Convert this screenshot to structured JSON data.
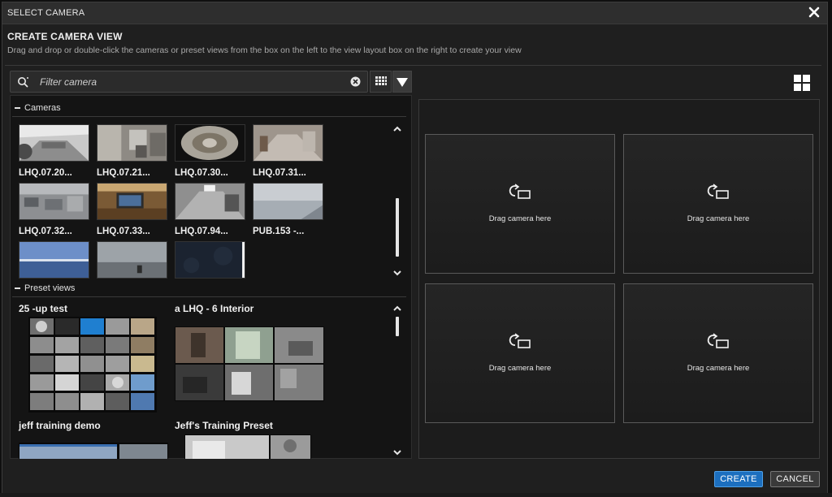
{
  "window": {
    "title": "SELECT CAMERA"
  },
  "header": {
    "title": "CREATE CAMERA VIEW",
    "instructions": "Drag and drop or double-click the cameras or preset views from the box on the left to the view layout box on the right to create your view"
  },
  "filter": {
    "placeholder": "Filter camera",
    "value": ""
  },
  "cameras": {
    "section_label": "Cameras",
    "items": [
      {
        "label": "LHQ.07.20..."
      },
      {
        "label": "LHQ.07.21..."
      },
      {
        "label": "LHQ.07.30..."
      },
      {
        "label": "LHQ.07.31..."
      },
      {
        "label": "LHQ.07.32..."
      },
      {
        "label": "LHQ.07.33..."
      },
      {
        "label": "LHQ.07.94..."
      },
      {
        "label": "PUB.153 -..."
      }
    ]
  },
  "presets": {
    "section_label": "Preset views",
    "items": [
      {
        "label": "25 -up test"
      },
      {
        "label": "a LHQ - 6 Interior"
      },
      {
        "label": "jeff training demo"
      },
      {
        "label": "Jeff's Training Preset"
      }
    ]
  },
  "layout": {
    "slots": [
      {
        "label": "Drag camera here"
      },
      {
        "label": "Drag camera here"
      },
      {
        "label": "Drag camera here"
      },
      {
        "label": "Drag camera here"
      }
    ]
  },
  "buttons": {
    "create": "CREATE",
    "cancel": "CANCEL"
  },
  "colors": {
    "primary": "#1c6fbf",
    "background": "#1f1f1f"
  }
}
